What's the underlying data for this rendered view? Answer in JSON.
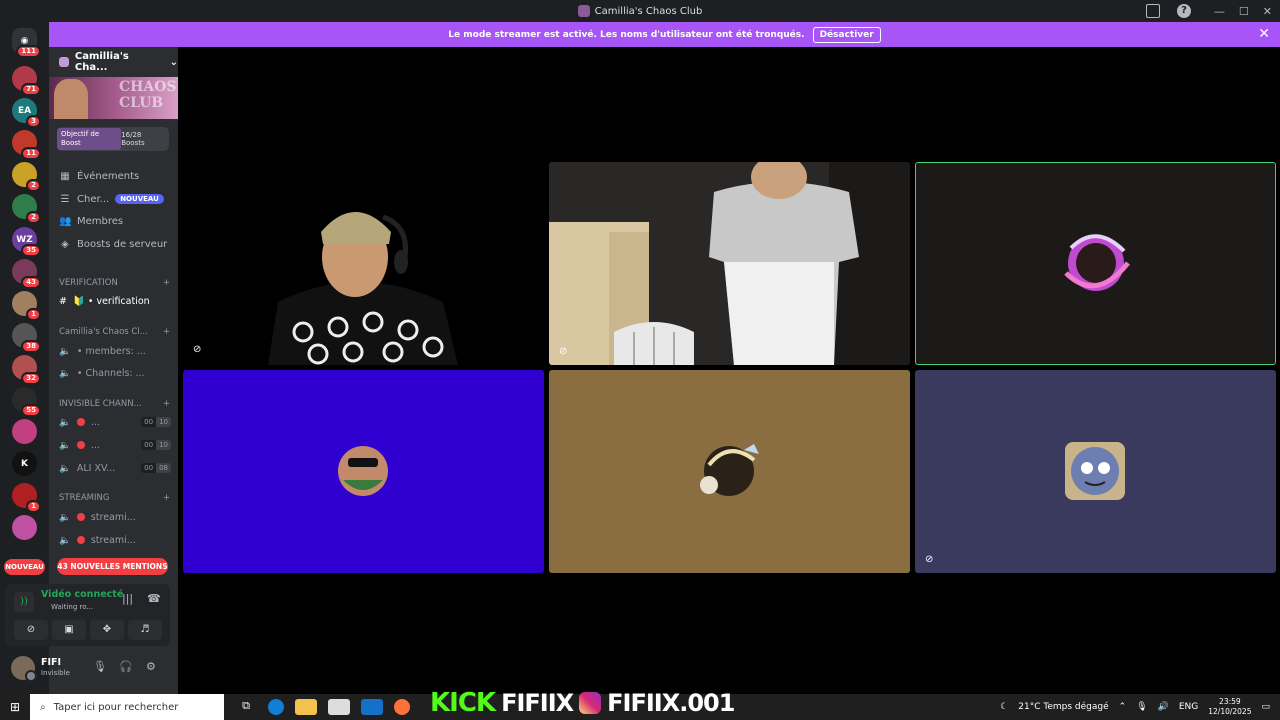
{
  "titlebar": {
    "title": "Camillia's Chaos Club"
  },
  "banner": {
    "message": "Le mode streamer est activé. Les noms d'utilisateur ont été tronqués.",
    "button": "Désactiver"
  },
  "rail": {
    "home_badge": "111",
    "servers": [
      {
        "badge": "71",
        "color": "#b23a48"
      },
      {
        "badge": "3",
        "color": "#1c7a7a",
        "label": "EA"
      },
      {
        "badge": "11",
        "color": "#c0392b"
      },
      {
        "badge": "2",
        "color": "#c9a227"
      },
      {
        "badge": "2",
        "color": "#2f7d4a"
      },
      {
        "badge": "35",
        "color": "#6b3fa0",
        "label": "WZ"
      },
      {
        "badge": "43",
        "color": "#7a3a5a"
      },
      {
        "badge": "1",
        "color": "#a08060"
      },
      {
        "badge": "38",
        "color": "#555555"
      },
      {
        "badge": "32",
        "color": "#b05050"
      },
      {
        "badge": "55",
        "color": "#2a2a2a"
      },
      {
        "badge": "",
        "color": "#c04080"
      },
      {
        "badge": "",
        "color": "#111111",
        "label": "K"
      },
      {
        "badge": "1",
        "color": "#b02020"
      },
      {
        "badge": "",
        "color": "#c050a0"
      }
    ],
    "new_label": "NOUVEAU"
  },
  "sidebar": {
    "guild_name": "Camillia's Cha...",
    "banner_text": "CHAOS CLUB",
    "boost": {
      "label": "Objectif de Boost",
      "count": "16/28 Boosts"
    },
    "nav": [
      {
        "label": "Événements",
        "icon": "calendar-icon"
      },
      {
        "label": "Cher...",
        "icon": "search-icon",
        "badge": "NOUVEAU"
      },
      {
        "label": "Membres",
        "icon": "members-icon"
      },
      {
        "label": "Boosts de serveur",
        "icon": "boost-icon"
      }
    ],
    "categories": {
      "verification": "VERIFICATION",
      "camillia": "Camillia's Chaos Cl...",
      "invisible": "INVISIBLE CHANN...",
      "streaming": "STREAMING"
    },
    "channels": {
      "verification": "🔰 • verification",
      "members": "• members: ...",
      "channels": "• Channels: ...",
      "inv1": "...",
      "inv2": "...",
      "inv3": "ALI XV...",
      "inv1_counts": [
        "00",
        "10"
      ],
      "inv2_counts": [
        "00",
        "10"
      ],
      "inv3_counts": [
        "00",
        "08"
      ],
      "stream1": "streami...",
      "stream2": "streami..."
    },
    "mentions": "43 NOUVELLES MENTIONS",
    "voice": {
      "status": "Vidéo connecté",
      "sub": "Waiting ro..."
    },
    "user": {
      "name": "FIFI",
      "status": "Invisible"
    }
  },
  "colors": {
    "banner": "#a855f7",
    "tile_blue": "#3000d0",
    "tile_tan": "#8a6e42",
    "tile_slate": "#3a3a5e",
    "speaking": "#43d36b"
  },
  "taskbar": {
    "search_placeholder": "Taper ici pour rechercher",
    "kick_name": "FIFIIX",
    "insta_name": "FIFIIX.001",
    "weather": "21°C  Temps dégagé",
    "lang": "ENG",
    "time": "23:59",
    "date": "12/10/2025"
  }
}
